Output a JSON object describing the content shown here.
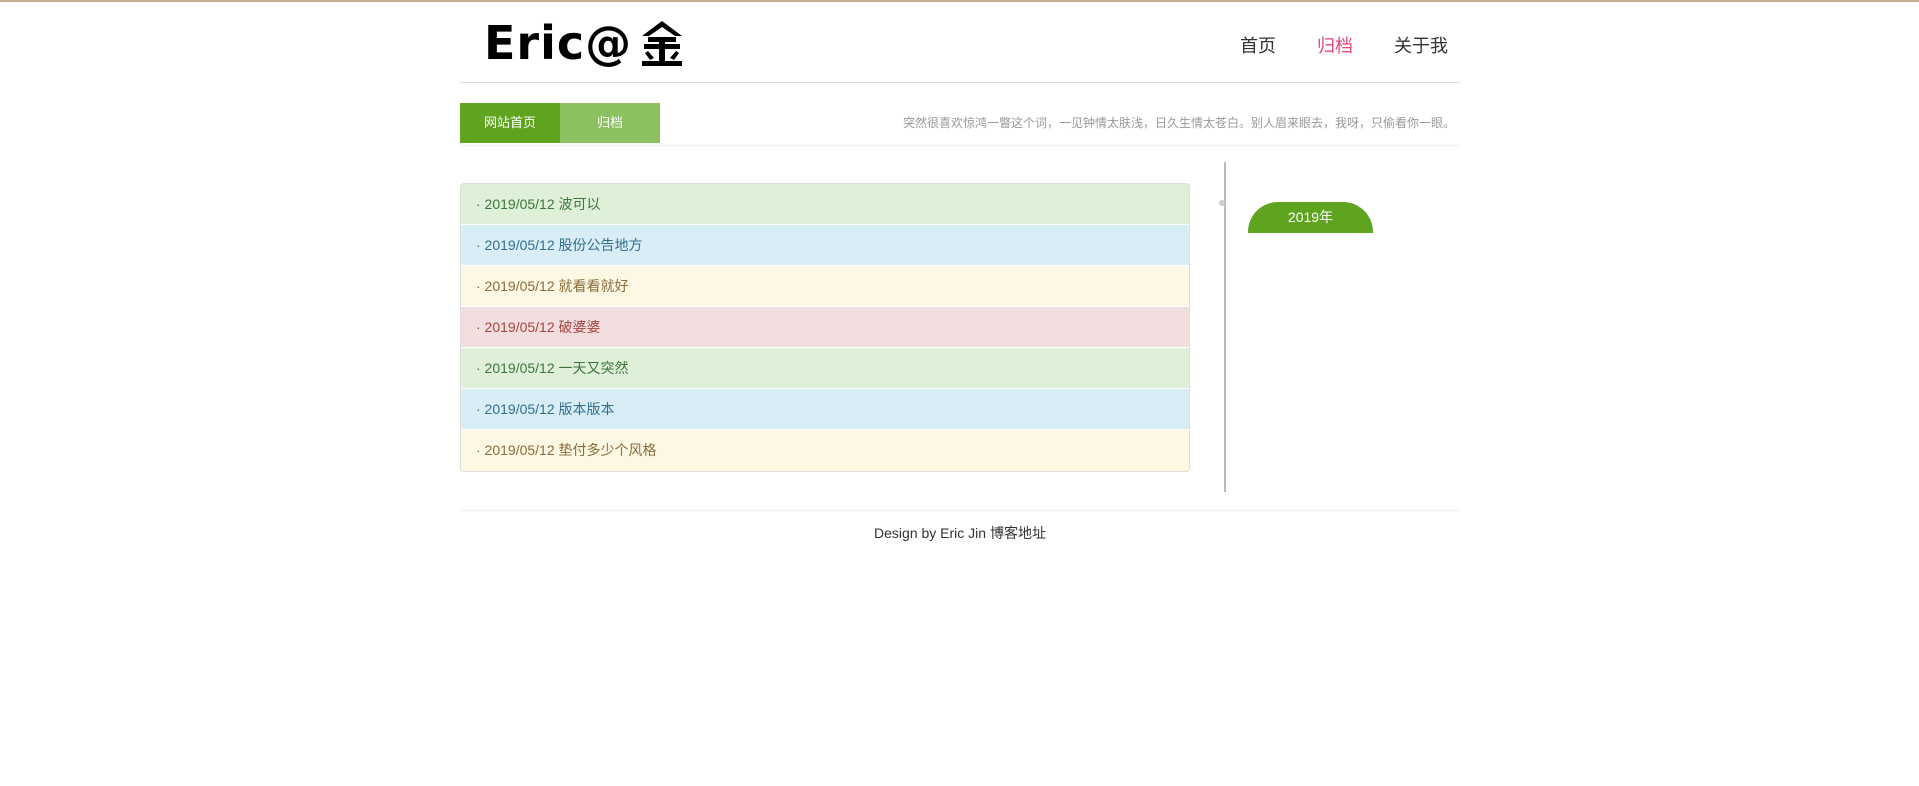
{
  "logo": {
    "text": "Eric@",
    "mark_icon": "jin-character-logo"
  },
  "nav": [
    {
      "label": "首页",
      "active": false
    },
    {
      "label": "归档",
      "active": true
    },
    {
      "label": "关于我",
      "active": false
    }
  ],
  "breadcrumb": {
    "home": "网站首页",
    "current": "归档"
  },
  "quote": "突然很喜欢惊鸿一瞥这个词，一见钟情太肤浅，日久生情太苍白。别人眉来眼去，我呀，只偷看你一眼。",
  "articles": [
    {
      "text": "· 2019/05/12 波可以",
      "style": "green"
    },
    {
      "text": "· 2019/05/12 股份公告地方",
      "style": "blue"
    },
    {
      "text": "· 2019/05/12 就看看就好",
      "style": "yellow"
    },
    {
      "text": "· 2019/05/12 破婆婆",
      "style": "red"
    },
    {
      "text": "· 2019/05/12 一天又突然",
      "style": "green"
    },
    {
      "text": "· 2019/05/12 版本版本",
      "style": "blue"
    },
    {
      "text": "· 2019/05/12 垫付多少个风格",
      "style": "yellow"
    }
  ],
  "timeline": {
    "year": "2019年"
  },
  "footer": {
    "design": "Design by Eric Jin",
    "link": "博客地址"
  },
  "colors": {
    "accent_green": "#5ea41e",
    "light_green": "#8bc25f",
    "nav_active": "#e5457a",
    "top_border": "#c8b493"
  }
}
